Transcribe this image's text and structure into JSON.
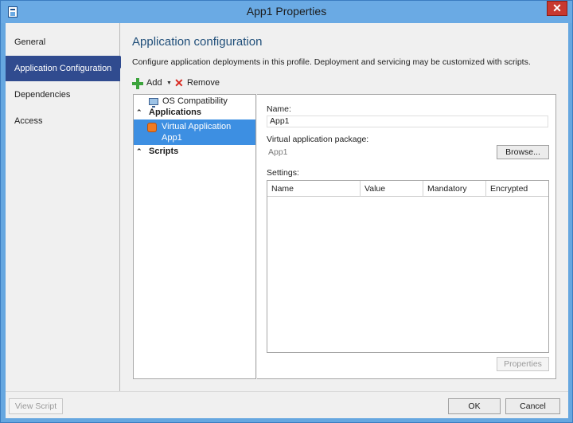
{
  "window": {
    "title": "App1 Properties",
    "close_glyph": "✕",
    "icon": "app-properties-icon"
  },
  "nav": {
    "items": [
      {
        "label": "General"
      },
      {
        "label": "Application Configuration"
      },
      {
        "label": "Dependencies"
      },
      {
        "label": "Access"
      }
    ],
    "selected": "Application Configuration"
  },
  "main": {
    "heading": "Application configuration",
    "description": "Configure application deployments in this profile. Deployment and servicing may be customized with scripts.",
    "toolbar": {
      "add_label": "Add",
      "add_dropdown_glyph": "▼",
      "remove_label": "Remove"
    }
  },
  "tree": {
    "os_compat": "OS Compatibility",
    "applications_header": "Applications",
    "selected_item": {
      "title": "Virtual Application",
      "subtitle": "App1"
    },
    "scripts_header": "Scripts",
    "collapse_glyph": "⌃"
  },
  "details": {
    "name_label": "Name:",
    "name_value": "App1",
    "package_label": "Virtual application package:",
    "package_value": "App1",
    "browse_label": "Browse...",
    "settings_label": "Settings:",
    "columns": [
      "Name",
      "Value",
      "Mandatory",
      "Encrypted"
    ],
    "properties_label": "Properties"
  },
  "footer": {
    "view_script": "View Script",
    "ok": "OK",
    "cancel": "Cancel"
  },
  "colors": {
    "titlebar": "#6aaae4",
    "nav_active": "#304b8f",
    "selection": "#3d8fe2",
    "close": "#c8382f",
    "heading": "#1f4e79"
  }
}
